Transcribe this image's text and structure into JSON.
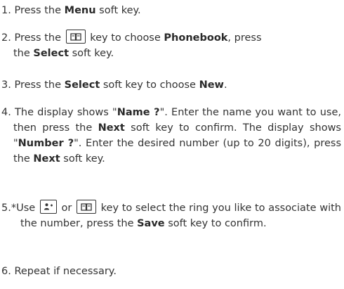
{
  "steps": [
    {
      "num": "1.",
      "t1": " Press the ",
      "b1": "Menu",
      "t2": " soft key."
    },
    {
      "num": "2.",
      "t1": " Press the ",
      "key_icon": "phonebook-key-icon",
      "t2": " key to choose ",
      "b1": "Phonebook",
      "t3": ", press",
      "t4": "the ",
      "b2": "Select",
      "t5": " soft key."
    },
    {
      "num": "3.",
      "t1": " Press the ",
      "b1": "Select",
      "t2": " soft key to choose ",
      "b2": "New",
      "t3": "."
    },
    {
      "num": "4.",
      "t1": " The display shows \"",
      "b1": "Name ?",
      "t2": "\". Enter the name you want to use, then press the ",
      "b2": "Next",
      "t3": " soft key to confirm. The display shows \"",
      "b3": "Number ?",
      "t4": "\". Enter the desired number (up to 20 digits), press the ",
      "b4": "Next",
      "t5": " soft key."
    },
    {
      "num": "5.*",
      "t1": "Use ",
      "key_icon_1": "contacts-key-icon",
      "t2": " or ",
      "key_icon_2": "phonebook-key-icon",
      "t3": " key to select the ring you like to associate with the number, press the ",
      "b1": "Save",
      "t4": " soft key to confirm."
    },
    {
      "num": "6.",
      "t1": " Repeat if necessary."
    }
  ]
}
